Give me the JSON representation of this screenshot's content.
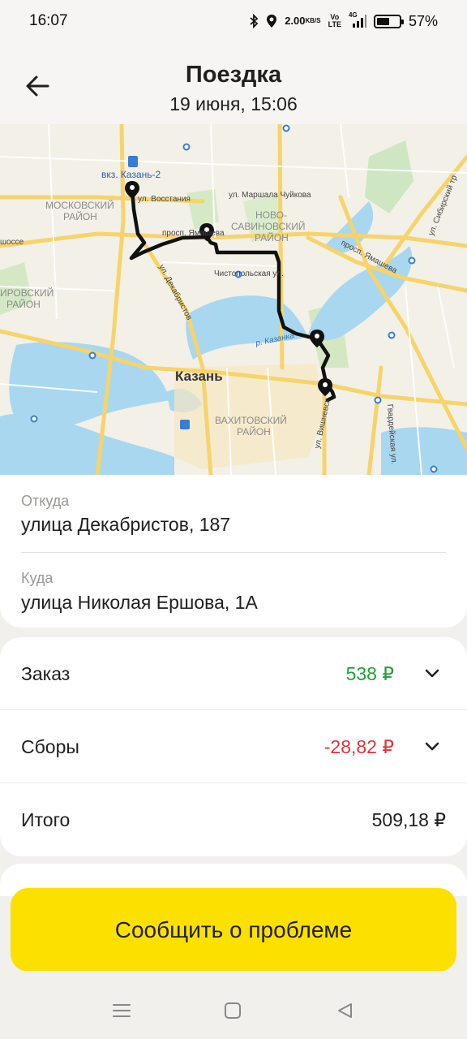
{
  "status_bar": {
    "time": "16:07",
    "net_speed_value": "2.00",
    "net_speed_unit": "KB/S",
    "volte": "Vo\nLTE",
    "network": "4G",
    "battery_percent": "57%",
    "battery_level": 0.57,
    "icons": [
      "bluetooth-icon",
      "location-icon",
      "signal-icon",
      "battery-icon"
    ]
  },
  "header": {
    "title": "Поездка",
    "subtitle": "19 июня, 15:06",
    "back_icon": "arrow-left-icon"
  },
  "map": {
    "labels": {
      "station": "вкз. Казань-2",
      "district_moscow_1": "МОСКОВСКИЙ",
      "district_moscow_2": "РАЙОН",
      "district_kirov_1": "ИРОВСКИЙ",
      "district_kirov_2": "РАЙОН",
      "district_novo_1": "НОВО-",
      "district_novo_2": "САВИНОВСКИЙ",
      "district_novo_3": "РАЙОН",
      "district_vakh_1": "ВАХИТОВСКИЙ",
      "district_vakh_2": "РАЙОН",
      "city": "Казань",
      "street_vosstaniya": "ул. Восстания",
      "street_chuikova": "ул. Маршала Чуйкова",
      "street_yamasheva": "просп. Ямашева",
      "street_chistopolskaya": "Чистопольская ул.",
      "street_dekabristov": "ул. Декабристов",
      "street_kazanka": "р. Казанка",
      "street_vishnevskogo": "ул. Вишневск",
      "street_sibirsky": "ул. Сибирский тр",
      "street_gvardeyskaya": "Гвардейская ул.",
      "street_shosse": "шоссе",
      "street_partial": "просп. Ямашева"
    }
  },
  "trip": {
    "from_label": "Откуда",
    "from_value": "улица Декабристов, 187",
    "to_label": "Куда",
    "to_value": "улица Николая Ершова, 1А"
  },
  "price": {
    "order_label": "Заказ",
    "order_value": "538 ₽",
    "order_color": "#21a038",
    "fees_label": "Сборы",
    "fees_value": "-28,82 ₽",
    "fees_color": "#e0333a",
    "total_label": "Итого",
    "total_value": "509,18 ₽"
  },
  "action": {
    "report_label": "Сообщить о проблеме",
    "color": "#fce000"
  },
  "nav_bar": {
    "icons": [
      "menu-icon",
      "home-square-icon",
      "back-triangle-icon"
    ]
  }
}
